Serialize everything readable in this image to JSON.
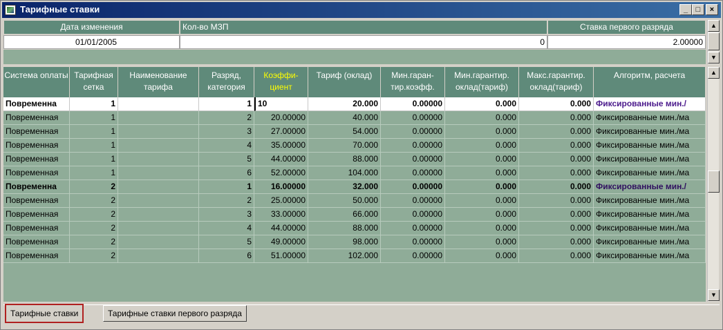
{
  "window": {
    "title": "Тарифные ставки",
    "min_label": "_",
    "max_label": "□",
    "close_label": "×"
  },
  "top_panel": {
    "headers": [
      "Дата изменения",
      "Кол-во МЗП",
      "Ставка первого разряда"
    ],
    "values": [
      "01/01/2005",
      "0",
      "2.00000"
    ]
  },
  "grid": {
    "columns": [
      "Система оплаты",
      "Тарифная сетка",
      "Наименование тарифа",
      "Разряд, категория",
      "Коэффи- циент",
      "Тариф (оклад)",
      "Мин.гаран- тир.коэфф.",
      "Мин.гарантир. оклад(тариф)",
      "Макс.гарантир. оклад(тариф)",
      "Алгоритм, расчета"
    ],
    "highlight_color": "#ffff00",
    "rows": [
      [
        "Повременна",
        "1",
        "",
        "1",
        "10",
        "20.000",
        "0.00000",
        "0.000",
        "0.000",
        "Фиксированные мин./"
      ],
      [
        "Повременная",
        "1",
        "",
        "2",
        "20.00000",
        "40.000",
        "0.00000",
        "0.000",
        "0.000",
        "Фиксированные мин./ма"
      ],
      [
        "Повременная",
        "1",
        "",
        "3",
        "27.00000",
        "54.000",
        "0.00000",
        "0.000",
        "0.000",
        "Фиксированные мин./ма"
      ],
      [
        "Повременная",
        "1",
        "",
        "4",
        "35.00000",
        "70.000",
        "0.00000",
        "0.000",
        "0.000",
        "Фиксированные мин./ма"
      ],
      [
        "Повременная",
        "1",
        "",
        "5",
        "44.00000",
        "88.000",
        "0.00000",
        "0.000",
        "0.000",
        "Фиксированные мин./ма"
      ],
      [
        "Повременная",
        "1",
        "",
        "6",
        "52.00000",
        "104.000",
        "0.00000",
        "0.000",
        "0.000",
        "Фиксированные мин./ма"
      ],
      [
        "Повременна",
        "2",
        "",
        "1",
        "16.00000",
        "32.000",
        "0.00000",
        "0.000",
        "0.000",
        "Фиксированные мин./"
      ],
      [
        "Повременная",
        "2",
        "",
        "2",
        "25.00000",
        "50.000",
        "0.00000",
        "0.000",
        "0.000",
        "Фиксированные мин./ма"
      ],
      [
        "Повременная",
        "2",
        "",
        "3",
        "33.00000",
        "66.000",
        "0.00000",
        "0.000",
        "0.000",
        "Фиксированные мин./ма"
      ],
      [
        "Повременная",
        "2",
        "",
        "4",
        "44.00000",
        "88.000",
        "0.00000",
        "0.000",
        "0.000",
        "Фиксированные мин./ма"
      ],
      [
        "Повременная",
        "2",
        "",
        "5",
        "49.00000",
        "98.000",
        "0.00000",
        "0.000",
        "0.000",
        "Фиксированные мин./ма"
      ],
      [
        "Повременная",
        "2",
        "",
        "6",
        "51.00000",
        "102.000",
        "0.00000",
        "0.000",
        "0.000",
        "Фиксированные мин./ма"
      ]
    ]
  },
  "tabs": [
    "Тарифные ставки",
    "Тарифные ставки первого разряда"
  ]
}
